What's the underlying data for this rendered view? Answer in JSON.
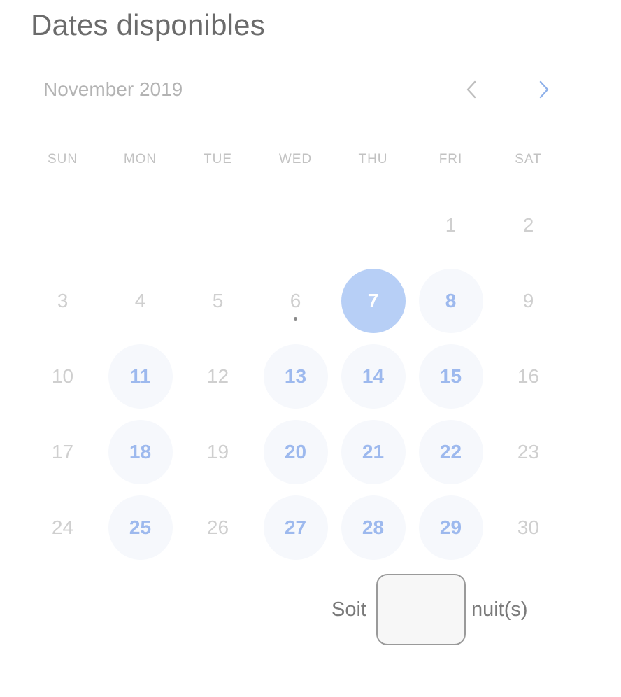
{
  "title": "Dates disponibles",
  "calendar": {
    "month_label": "November 2019",
    "prev_icon": "chevron-left-icon",
    "next_icon": "chevron-right-icon",
    "nav_prev_color": "#bdbdbd",
    "nav_next_color": "#8fb1ea",
    "weekdays": [
      "SUN",
      "MON",
      "TUE",
      "WED",
      "THU",
      "FRI",
      "SAT"
    ],
    "weeks": [
      [
        {
          "day": ""
        },
        {
          "day": ""
        },
        {
          "day": ""
        },
        {
          "day": ""
        },
        {
          "day": ""
        },
        {
          "day": "1",
          "state": "disabled"
        },
        {
          "day": "2",
          "state": "disabled"
        }
      ],
      [
        {
          "day": "3",
          "state": "disabled"
        },
        {
          "day": "4",
          "state": "disabled"
        },
        {
          "day": "5",
          "state": "disabled"
        },
        {
          "day": "6",
          "state": "disabled",
          "today": true
        },
        {
          "day": "7",
          "state": "selected"
        },
        {
          "day": "8",
          "state": "available"
        },
        {
          "day": "9",
          "state": "disabled"
        }
      ],
      [
        {
          "day": "10",
          "state": "disabled"
        },
        {
          "day": "11",
          "state": "available"
        },
        {
          "day": "12",
          "state": "disabled"
        },
        {
          "day": "13",
          "state": "available"
        },
        {
          "day": "14",
          "state": "available"
        },
        {
          "day": "15",
          "state": "available"
        },
        {
          "day": "16",
          "state": "disabled"
        }
      ],
      [
        {
          "day": "17",
          "state": "disabled"
        },
        {
          "day": "18",
          "state": "available"
        },
        {
          "day": "19",
          "state": "disabled"
        },
        {
          "day": "20",
          "state": "available"
        },
        {
          "day": "21",
          "state": "available"
        },
        {
          "day": "22",
          "state": "available"
        },
        {
          "day": "23",
          "state": "disabled"
        }
      ],
      [
        {
          "day": "24",
          "state": "disabled"
        },
        {
          "day": "25",
          "state": "available"
        },
        {
          "day": "26",
          "state": "disabled"
        },
        {
          "day": "27",
          "state": "available"
        },
        {
          "day": "28",
          "state": "available"
        },
        {
          "day": "29",
          "state": "available"
        },
        {
          "day": "30",
          "state": "disabled"
        }
      ]
    ]
  },
  "nights": {
    "prefix": "Soit",
    "value": "",
    "suffix": "nuit(s)"
  },
  "colors": {
    "selected_bg": "#b7cff6",
    "available_text": "#9db9ee",
    "available_bg": "#f6f8fc",
    "disabled_text": "#cfcfcf"
  }
}
